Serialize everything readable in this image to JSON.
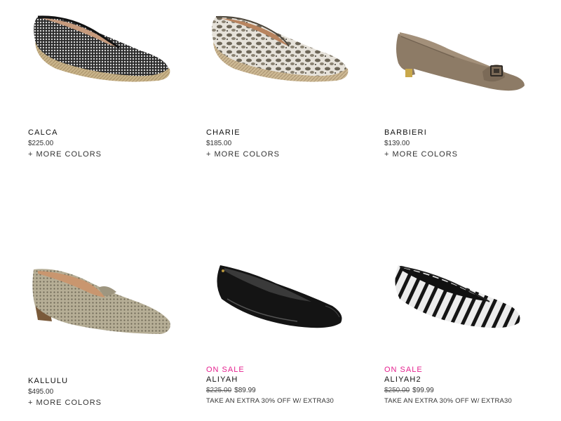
{
  "products": [
    {
      "name": "CALCA",
      "price": "$225.00",
      "more": "+ MORE COLORS"
    },
    {
      "name": "CHARIE",
      "price": "$185.00",
      "more": "+ MORE COLORS"
    },
    {
      "name": "BARBIERI",
      "price": "$139.00",
      "more": "+ MORE COLORS"
    },
    {
      "name": "KALLULU",
      "price": "$495.00",
      "more": "+ MORE COLORS"
    },
    {
      "sale": "ON SALE",
      "name": "ALIYAH",
      "orig_price": "$225.00",
      "price": "$89.99",
      "promo": "TAKE AN EXTRA 30% OFF W/ EXTRA30"
    },
    {
      "sale": "ON SALE",
      "name": "ALIYAH2",
      "orig_price": "$250.00",
      "price": "$99.99",
      "promo": "TAKE AN EXTRA 30% OFF W/ EXTRA30"
    }
  ],
  "colors": {
    "sale": "#e5218f",
    "text": "#222222",
    "background": "#ffffff"
  }
}
